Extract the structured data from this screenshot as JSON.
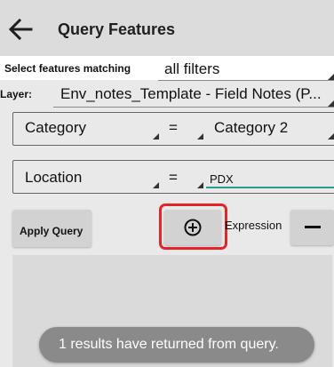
{
  "header": {
    "title": "Query Features",
    "back_icon": "arrow-left-icon"
  },
  "filter": {
    "match_label": "Select features matching",
    "match_value": "all filters"
  },
  "layer": {
    "label": "Layer:",
    "value": "Env_notes_Template - Field Notes (P..."
  },
  "conditions": [
    {
      "field": "Category",
      "operator": "=",
      "value": "Category 2"
    },
    {
      "field": "Location",
      "operator": "=",
      "value": "PDX"
    }
  ],
  "actions": {
    "apply_label": "Apply Query",
    "add_icon": "plus-circle-icon",
    "expression_label": "Expression",
    "remove_icon": "minus-icon"
  },
  "toast": {
    "message": "1 results have returned from query."
  },
  "colors": {
    "highlight": "#e3242b",
    "accent": "#2a9d8f"
  }
}
